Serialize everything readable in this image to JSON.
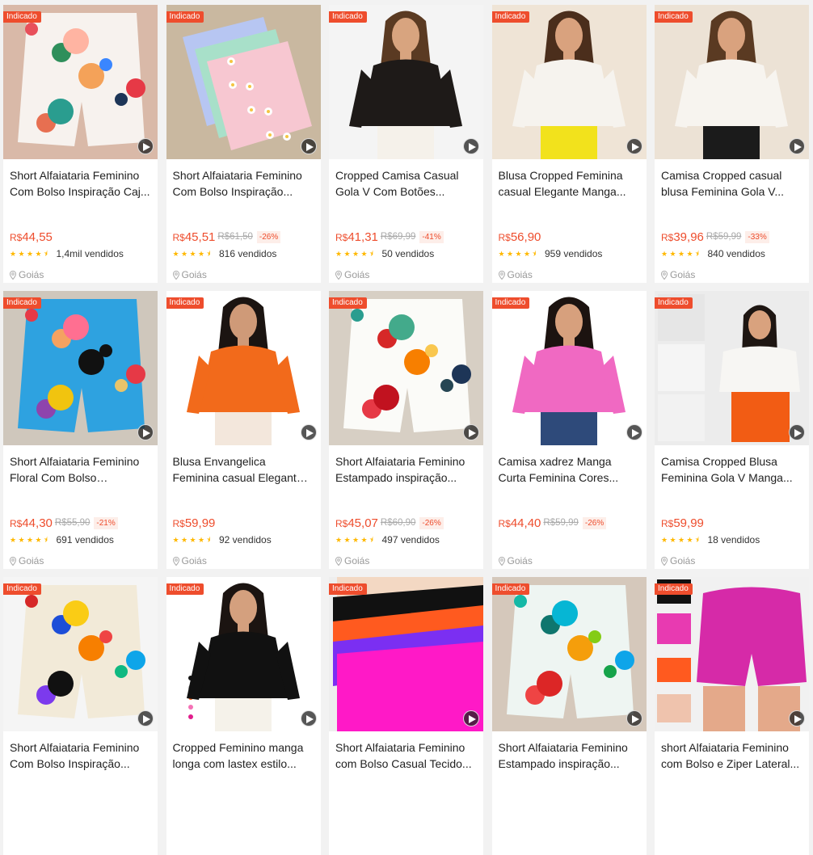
{
  "colors": {
    "accent": "#ee4d2d",
    "star": "#ffb800",
    "muted": "#999999"
  },
  "badge_label": "Indicado",
  "products": [
    {
      "title": "Short Alfaiataria Feminino Com Bolso Inspiração Caj...",
      "price_cur": "R$",
      "price_val": "44,55",
      "old_price": "",
      "discount": "",
      "rating": "4.5",
      "sold": "1,4mil vendidos",
      "location": "Goiás",
      "badge": true,
      "image": "shorts-floral-white"
    },
    {
      "title": "Short Alfaiataria Feminino Com Bolso Inspiração...",
      "price_cur": "R$",
      "price_val": "45,51",
      "old_price": "R$61,50",
      "discount": "-26%",
      "rating": "4.5",
      "sold": "816 vendidos",
      "location": "Goiás",
      "badge": true,
      "image": "shorts-pastel-daisy"
    },
    {
      "title": "Cropped Camisa Casual Gola V Com Botões...",
      "price_cur": "R$",
      "price_val": "41,31",
      "old_price": "R$69,99",
      "discount": "-41%",
      "rating": "4.5",
      "sold": "50 vendidos",
      "location": "Goiás",
      "badge": true,
      "image": "black-crop-blouse"
    },
    {
      "title": "Blusa Cropped Feminina casual Elegante Manga...",
      "price_cur": "R$",
      "price_val": "56,90",
      "old_price": "",
      "discount": "",
      "rating": "4.5",
      "sold": "959 vendidos",
      "location": "Goiás",
      "badge": true,
      "image": "white-blouse-yellow"
    },
    {
      "title": "Camisa Cropped casual blusa Feminina Gola V...",
      "price_cur": "R$",
      "price_val": "39,96",
      "old_price": "R$59,99",
      "discount": "-33%",
      "rating": "4.5",
      "sold": "840 vendidos",
      "location": "Goiás",
      "badge": true,
      "image": "white-blouse-black"
    },
    {
      "title": "Short Alfaiataria Feminino Floral Com Bolso Estampa...",
      "price_cur": "R$",
      "price_val": "44,30",
      "old_price": "R$55,90",
      "discount": "-21%",
      "rating": "4.5",
      "sold": "691 vendidos",
      "location": "Goiás",
      "badge": true,
      "image": "shorts-blue-toucan"
    },
    {
      "title": "Blusa Envangelica Feminina casual Elegante Manga...",
      "price_cur": "R$",
      "price_val": "59,99",
      "old_price": "",
      "discount": "",
      "rating": "4.5",
      "sold": "92 vendidos",
      "location": "Goiás",
      "badge": true,
      "image": "orange-blouse"
    },
    {
      "title": "Short Alfaiataria Feminino Estampado inspiração...",
      "price_cur": "R$",
      "price_val": "45,07",
      "old_price": "R$60,90",
      "discount": "-26%",
      "rating": "4.5",
      "sold": "497 vendidos",
      "location": "Goiás",
      "badge": true,
      "image": "shorts-tropical-bird"
    },
    {
      "title": "Camisa xadrez Manga Curta Feminina Cores...",
      "price_cur": "R$",
      "price_val": "44,40",
      "old_price": "R$59,99",
      "discount": "-26%",
      "rating": "",
      "sold": "",
      "location": "Goiás",
      "badge": true,
      "image": "pink-gingham-shirt"
    },
    {
      "title": "Camisa Cropped Blusa Feminina Gola V Manga...",
      "price_cur": "R$",
      "price_val": "59,99",
      "old_price": "",
      "discount": "",
      "rating": "4.5",
      "sold": "18 vendidos",
      "location": "Goiás",
      "badge": true,
      "image": "white-blouse-orange-shorts"
    },
    {
      "title": "Short Alfaiataria Feminino Com Bolso Inspiração...",
      "price_cur": "R$",
      "price_val": "",
      "old_price": "",
      "discount": "",
      "rating": "",
      "sold": "",
      "location": "",
      "badge": true,
      "image": "shorts-colorful-toucan"
    },
    {
      "title": "Cropped Feminino manga longa com lastex estilo...",
      "price_cur": "R$",
      "price_val": "",
      "old_price": "",
      "discount": "",
      "rating": "",
      "sold": "",
      "location": "",
      "badge": true,
      "image": "black-puff-crop"
    },
    {
      "title": "Short Alfaiataria Feminino com Bolso Casual Tecido...",
      "price_cur": "R$",
      "price_val": "",
      "old_price": "",
      "discount": "",
      "rating": "",
      "sold": "",
      "location": "",
      "badge": true,
      "image": "shorts-stack-colors"
    },
    {
      "title": "Short Alfaiataria Feminino Estampado inspiração...",
      "price_cur": "R$",
      "price_val": "",
      "old_price": "",
      "discount": "",
      "rating": "",
      "sold": "",
      "location": "",
      "badge": true,
      "image": "shorts-teal-parrot"
    },
    {
      "title": "short Alfaiataria Feminino com Bolso e Ziper Lateral...",
      "price_cur": "R$",
      "price_val": "",
      "old_price": "",
      "discount": "",
      "rating": "",
      "sold": "",
      "location": "",
      "badge": true,
      "image": "shorts-magenta"
    }
  ]
}
